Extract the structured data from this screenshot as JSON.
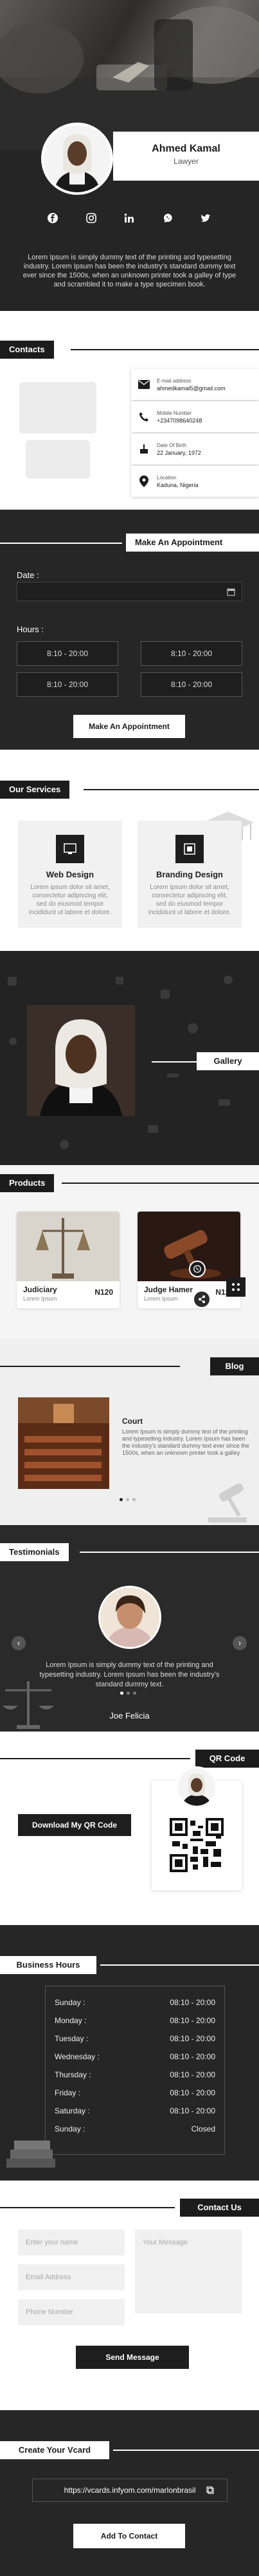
{
  "profile": {
    "name": "Ahmed Kamal",
    "role": "Lawyer",
    "bio": "Lorem Ipsum is simply dummy text of the printing and typesetting industry. Lorem Ipsum has been the industry's standard dummy text ever since the 1500s, when an unknown printer took a galley of type and scrambled it to make a type specimen book.",
    "socials": [
      "facebook-icon",
      "instagram-icon",
      "linkedin-icon",
      "whatsapp-icon",
      "twitter-icon"
    ]
  },
  "contacts": {
    "title": "Contacts",
    "items": [
      {
        "label": "E-mail address",
        "value": "ahmedkamal5@gmail.com",
        "icon": "envelope-icon"
      },
      {
        "label": "Mobile Number",
        "value": "+2347098640248",
        "icon": "phone-icon"
      },
      {
        "label": "Date Of Birth",
        "value": "22 January, 1972",
        "icon": "cake-icon"
      },
      {
        "label": "Location",
        "value": "Kaduna, Nigeria",
        "icon": "location-icon"
      }
    ]
  },
  "appointment": {
    "title": "Make An Appointment",
    "date_label": "Date :",
    "hours_label": "Hours :",
    "slots": [
      "8:10 - 20:00",
      "8:10 - 20:00",
      "8:10 - 20:00",
      "8:10 - 20:00"
    ],
    "button": "Make An Appointment"
  },
  "services": {
    "title": "Our Services",
    "items": [
      {
        "name": "Web Design",
        "desc": "Lorem ipsum dolor sit amet, consectetur adipiscing elit, sed do eiusmod tempor incididunt ut labore et dolore."
      },
      {
        "name": "Branding Design",
        "desc": "Lorem ipsum dolor sit amet, consectetur adipiscing elit, sed do eiusmod tempor incididunt ut labore et dolore."
      }
    ]
  },
  "gallery": {
    "title": "Gallery"
  },
  "products": {
    "title": "Products",
    "items": [
      {
        "name": "Judiciary",
        "sub": "Lorem Ipsum",
        "price": "N120"
      },
      {
        "name": "Judge Hamer",
        "sub": "Lorem Ipsum",
        "price": "N120"
      }
    ]
  },
  "blog": {
    "title": "Blog",
    "post_title": "Court",
    "post_text": "Lorem Ipsum is simply dummy text of the printing and typesetting industry. Lorem Ipsum has been the industry's standard dummy text ever since the 1500s, when an unknown printer took a galley."
  },
  "testimonials": {
    "title": "Testimonials",
    "text": "Lorem Ipsum is simply dummy text of the printing and typesetting industry. Lorem Ipsum has been the industry's standard dummy text.",
    "name": "Joe Felicia"
  },
  "qr": {
    "title": "QR Code",
    "button": "Download My QR Code"
  },
  "hours": {
    "title": "Business Hours",
    "rows": [
      {
        "day": "Sunday :",
        "time": "08:10 - 20:00"
      },
      {
        "day": "Monday :",
        "time": "08:10 - 20:00"
      },
      {
        "day": "Tuesday :",
        "time": "08:10 - 20:00"
      },
      {
        "day": "Wednesday :",
        "time": "08:10 - 20:00"
      },
      {
        "day": "Thursday :",
        "time": "08:10 - 20:00"
      },
      {
        "day": "Friday :",
        "time": "08:10 - 20:00"
      },
      {
        "day": "Saturday :",
        "time": "08:10 - 20:00"
      },
      {
        "day": "Sunday :",
        "time": "Closed"
      }
    ]
  },
  "contact_us": {
    "title": "Contact Us",
    "name_placeholder": "Enter your name",
    "message_placeholder": "Your Message",
    "email_placeholder": "Email Address",
    "phone_placeholder": "Phone Number",
    "button": "Send Message"
  },
  "vcard": {
    "title": "Create Your Vcard",
    "url": "https://vcards.infyom.com/marlonbrasil",
    "button": "Add To Contact"
  }
}
